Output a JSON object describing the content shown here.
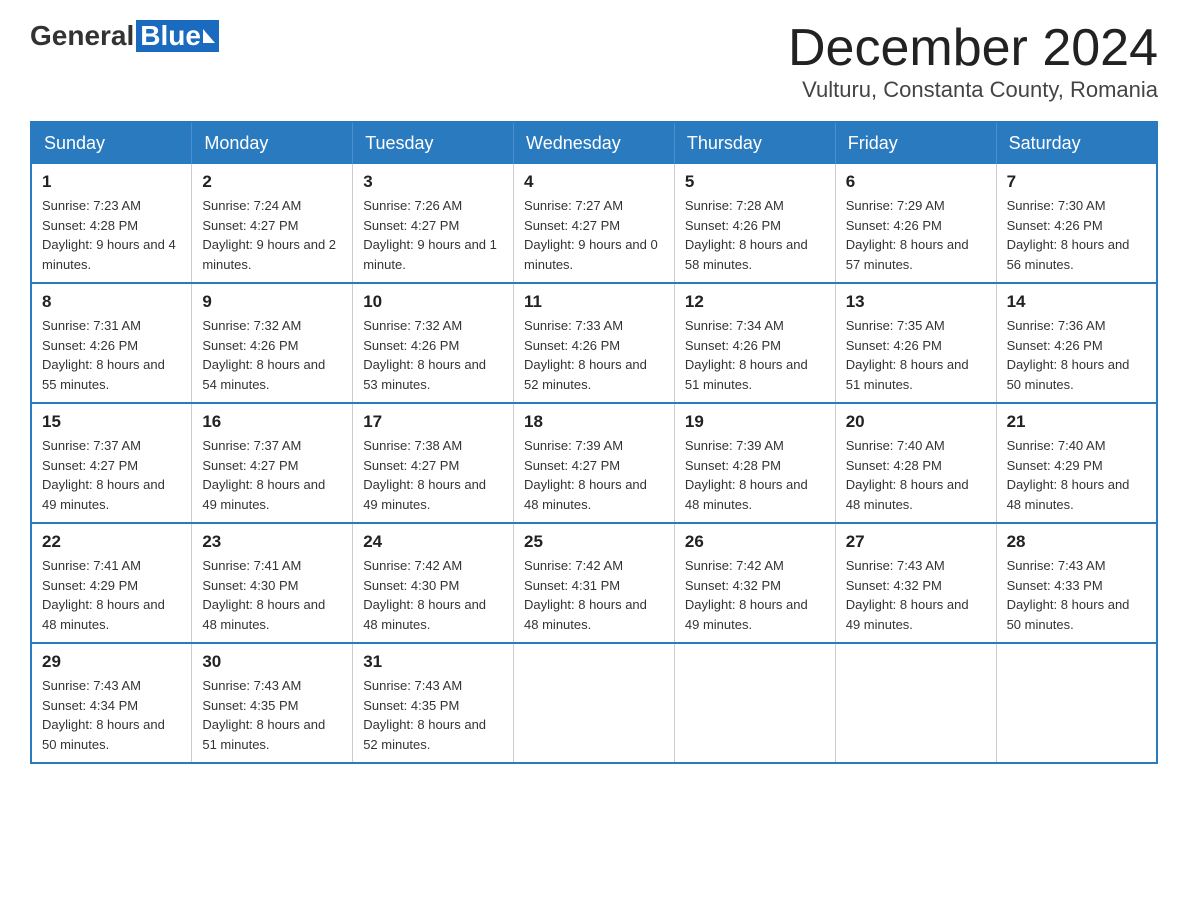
{
  "logo": {
    "general": "General",
    "blue": "Blue"
  },
  "title": "December 2024",
  "subtitle": "Vulturu, Constanta County, Romania",
  "days_of_week": [
    "Sunday",
    "Monday",
    "Tuesday",
    "Wednesday",
    "Thursday",
    "Friday",
    "Saturday"
  ],
  "weeks": [
    [
      {
        "day": "1",
        "sunrise": "7:23 AM",
        "sunset": "4:28 PM",
        "daylight": "9 hours and 4 minutes."
      },
      {
        "day": "2",
        "sunrise": "7:24 AM",
        "sunset": "4:27 PM",
        "daylight": "9 hours and 2 minutes."
      },
      {
        "day": "3",
        "sunrise": "7:26 AM",
        "sunset": "4:27 PM",
        "daylight": "9 hours and 1 minute."
      },
      {
        "day": "4",
        "sunrise": "7:27 AM",
        "sunset": "4:27 PM",
        "daylight": "9 hours and 0 minutes."
      },
      {
        "day": "5",
        "sunrise": "7:28 AM",
        "sunset": "4:26 PM",
        "daylight": "8 hours and 58 minutes."
      },
      {
        "day": "6",
        "sunrise": "7:29 AM",
        "sunset": "4:26 PM",
        "daylight": "8 hours and 57 minutes."
      },
      {
        "day": "7",
        "sunrise": "7:30 AM",
        "sunset": "4:26 PM",
        "daylight": "8 hours and 56 minutes."
      }
    ],
    [
      {
        "day": "8",
        "sunrise": "7:31 AM",
        "sunset": "4:26 PM",
        "daylight": "8 hours and 55 minutes."
      },
      {
        "day": "9",
        "sunrise": "7:32 AM",
        "sunset": "4:26 PM",
        "daylight": "8 hours and 54 minutes."
      },
      {
        "day": "10",
        "sunrise": "7:32 AM",
        "sunset": "4:26 PM",
        "daylight": "8 hours and 53 minutes."
      },
      {
        "day": "11",
        "sunrise": "7:33 AM",
        "sunset": "4:26 PM",
        "daylight": "8 hours and 52 minutes."
      },
      {
        "day": "12",
        "sunrise": "7:34 AM",
        "sunset": "4:26 PM",
        "daylight": "8 hours and 51 minutes."
      },
      {
        "day": "13",
        "sunrise": "7:35 AM",
        "sunset": "4:26 PM",
        "daylight": "8 hours and 51 minutes."
      },
      {
        "day": "14",
        "sunrise": "7:36 AM",
        "sunset": "4:26 PM",
        "daylight": "8 hours and 50 minutes."
      }
    ],
    [
      {
        "day": "15",
        "sunrise": "7:37 AM",
        "sunset": "4:27 PM",
        "daylight": "8 hours and 49 minutes."
      },
      {
        "day": "16",
        "sunrise": "7:37 AM",
        "sunset": "4:27 PM",
        "daylight": "8 hours and 49 minutes."
      },
      {
        "day": "17",
        "sunrise": "7:38 AM",
        "sunset": "4:27 PM",
        "daylight": "8 hours and 49 minutes."
      },
      {
        "day": "18",
        "sunrise": "7:39 AM",
        "sunset": "4:27 PM",
        "daylight": "8 hours and 48 minutes."
      },
      {
        "day": "19",
        "sunrise": "7:39 AM",
        "sunset": "4:28 PM",
        "daylight": "8 hours and 48 minutes."
      },
      {
        "day": "20",
        "sunrise": "7:40 AM",
        "sunset": "4:28 PM",
        "daylight": "8 hours and 48 minutes."
      },
      {
        "day": "21",
        "sunrise": "7:40 AM",
        "sunset": "4:29 PM",
        "daylight": "8 hours and 48 minutes."
      }
    ],
    [
      {
        "day": "22",
        "sunrise": "7:41 AM",
        "sunset": "4:29 PM",
        "daylight": "8 hours and 48 minutes."
      },
      {
        "day": "23",
        "sunrise": "7:41 AM",
        "sunset": "4:30 PM",
        "daylight": "8 hours and 48 minutes."
      },
      {
        "day": "24",
        "sunrise": "7:42 AM",
        "sunset": "4:30 PM",
        "daylight": "8 hours and 48 minutes."
      },
      {
        "day": "25",
        "sunrise": "7:42 AM",
        "sunset": "4:31 PM",
        "daylight": "8 hours and 48 minutes."
      },
      {
        "day": "26",
        "sunrise": "7:42 AM",
        "sunset": "4:32 PM",
        "daylight": "8 hours and 49 minutes."
      },
      {
        "day": "27",
        "sunrise": "7:43 AM",
        "sunset": "4:32 PM",
        "daylight": "8 hours and 49 minutes."
      },
      {
        "day": "28",
        "sunrise": "7:43 AM",
        "sunset": "4:33 PM",
        "daylight": "8 hours and 50 minutes."
      }
    ],
    [
      {
        "day": "29",
        "sunrise": "7:43 AM",
        "sunset": "4:34 PM",
        "daylight": "8 hours and 50 minutes."
      },
      {
        "day": "30",
        "sunrise": "7:43 AM",
        "sunset": "4:35 PM",
        "daylight": "8 hours and 51 minutes."
      },
      {
        "day": "31",
        "sunrise": "7:43 AM",
        "sunset": "4:35 PM",
        "daylight": "8 hours and 52 minutes."
      },
      null,
      null,
      null,
      null
    ]
  ],
  "labels": {
    "sunrise_prefix": "Sunrise: ",
    "sunset_prefix": "Sunset: ",
    "daylight_prefix": "Daylight: "
  }
}
